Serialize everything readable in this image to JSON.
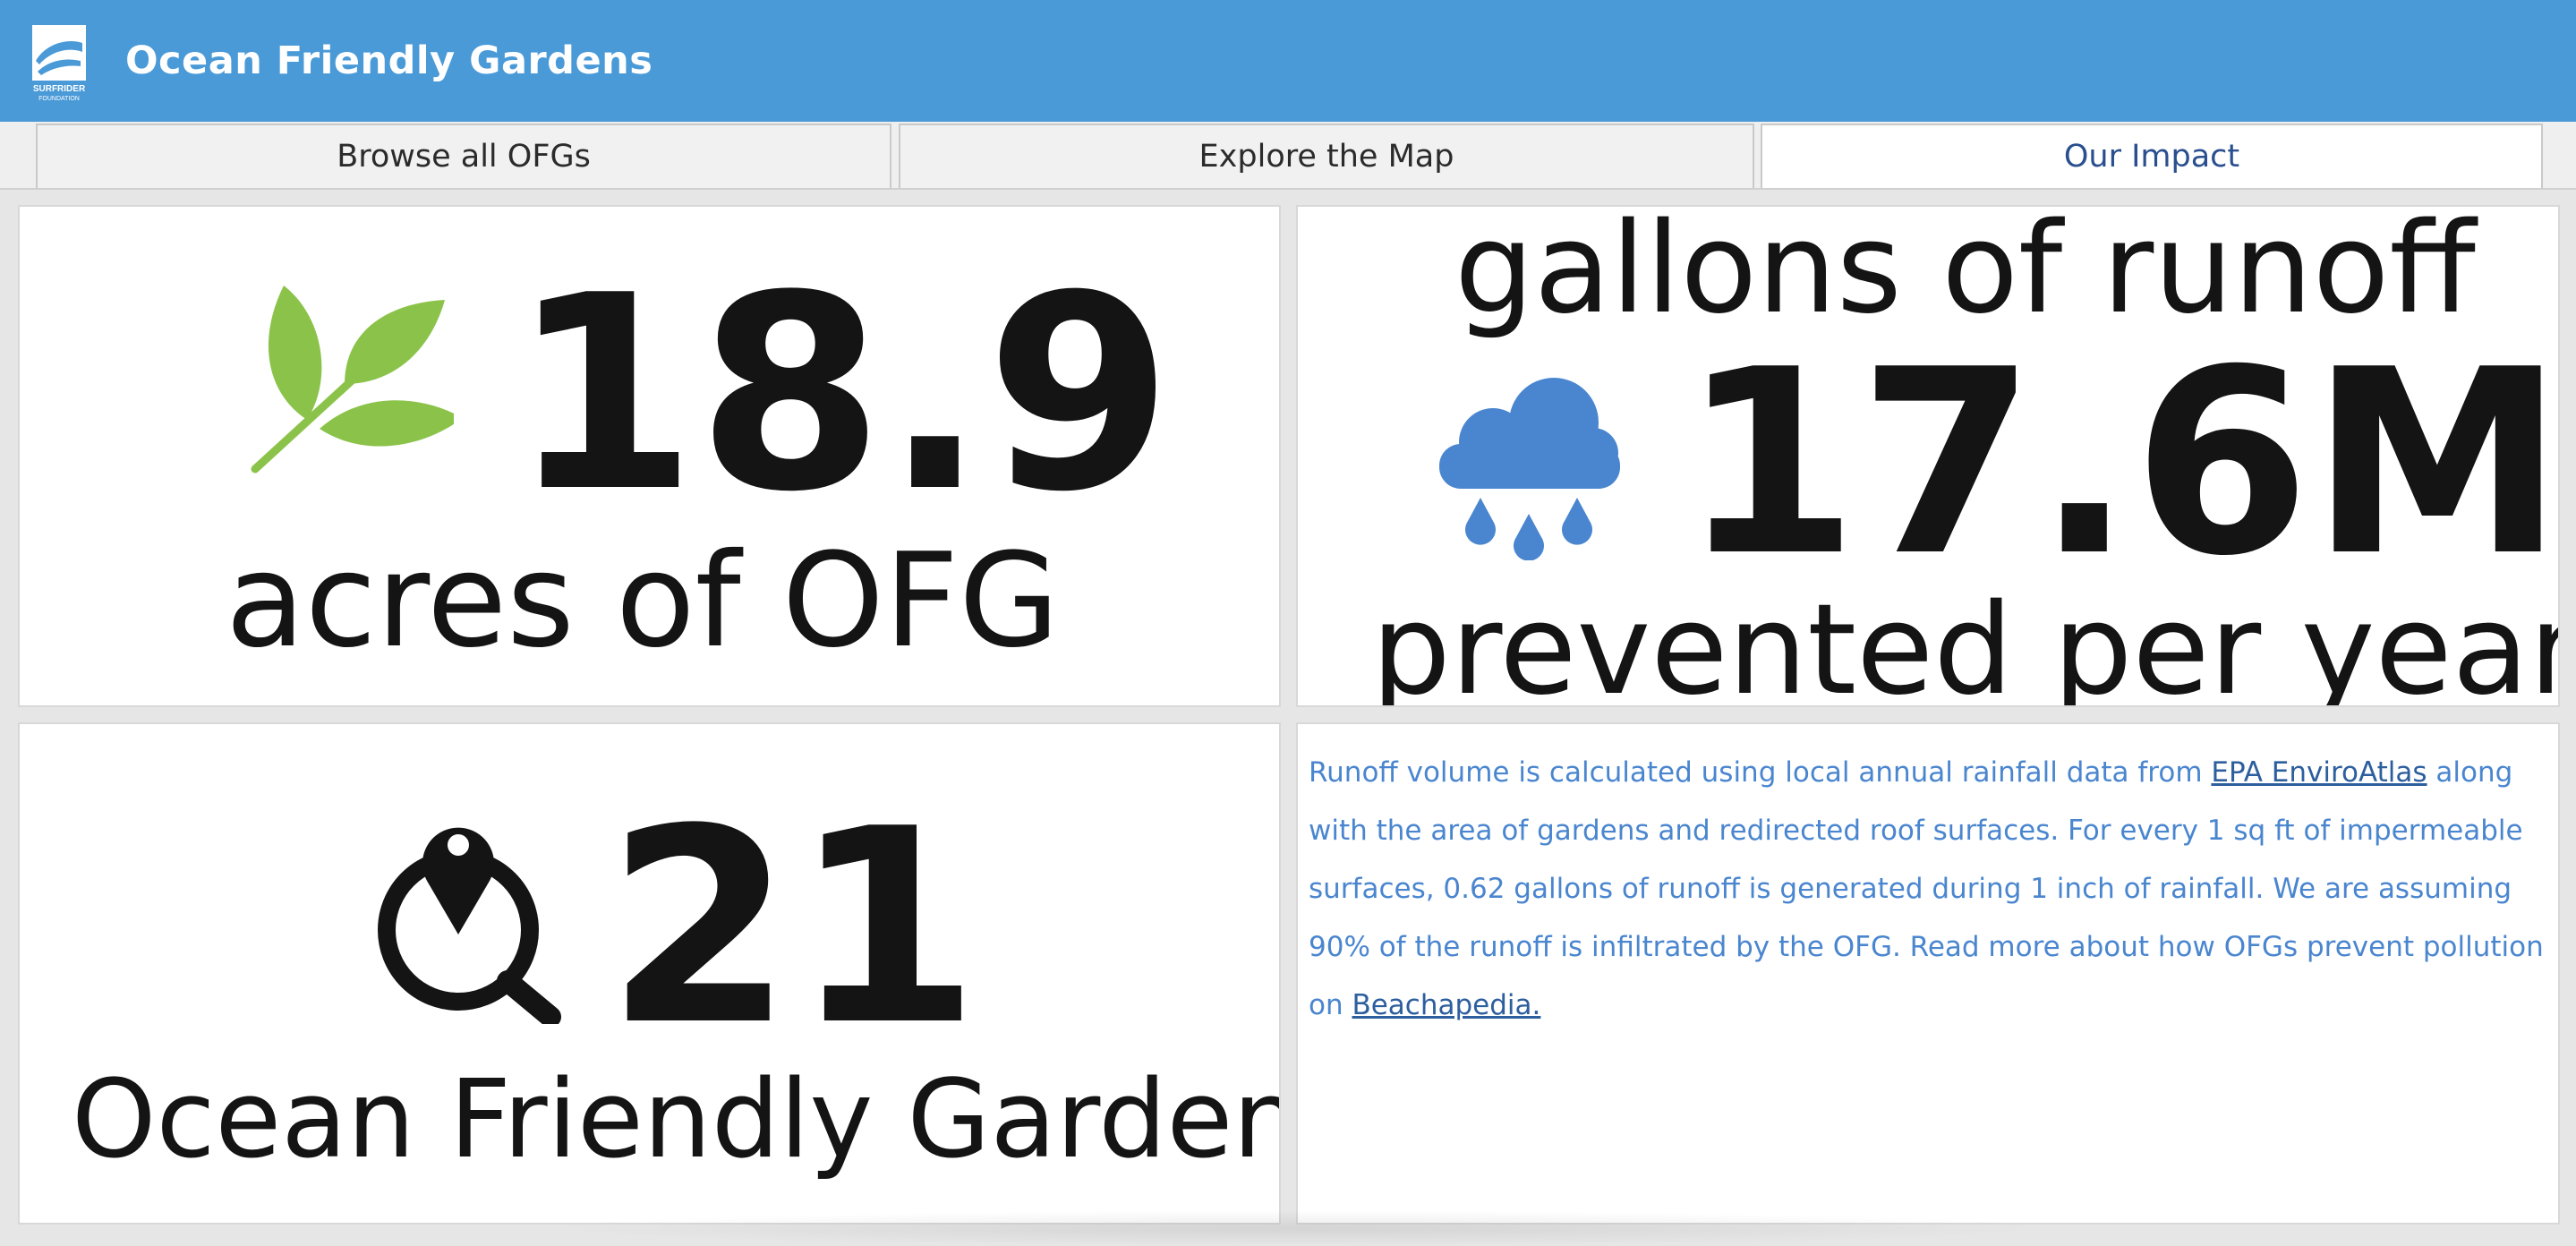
{
  "app": {
    "title": "Ocean Friendly Gardens",
    "logo_text": "SURFRIDER",
    "logo_subtext": "FOUNDATION",
    "header_color": "#4a9ad8"
  },
  "tabs": [
    {
      "label": "Browse all OFGs",
      "active": false
    },
    {
      "label": "Explore the Map",
      "active": false
    },
    {
      "label": "Our Impact",
      "active": true
    }
  ],
  "acres": {
    "value": "18.9",
    "caption": "acres of OFG",
    "icon": "leaf-icon",
    "icon_color": "#8bc34a"
  },
  "runoff": {
    "top_caption": "gallons of runoff",
    "value": "17.6M",
    "bottom_caption": "prevented per year",
    "icon": "rain-cloud-icon",
    "icon_color": "#4a86cf"
  },
  "gardens": {
    "value": "21",
    "caption": "Ocean Friendly Gardens",
    "icon": "location-search-icon"
  },
  "note": {
    "part1": "Runoff volume is calculated using local annual rainfall data from ",
    "link1": "EPA EnviroAtlas",
    "part2": " along with the area of gardens and redirected roof surfaces. For every 1 sq ft of impermeable surfaces, 0.62 gallons of runoff is generated during 1 inch of rainfall. We are assuming 90% of the runoff is infiltrated by the OFG. Read more about how OFGs prevent pollution on ",
    "link2": "Beachapedia.",
    "text_color": "#4a86cf"
  }
}
